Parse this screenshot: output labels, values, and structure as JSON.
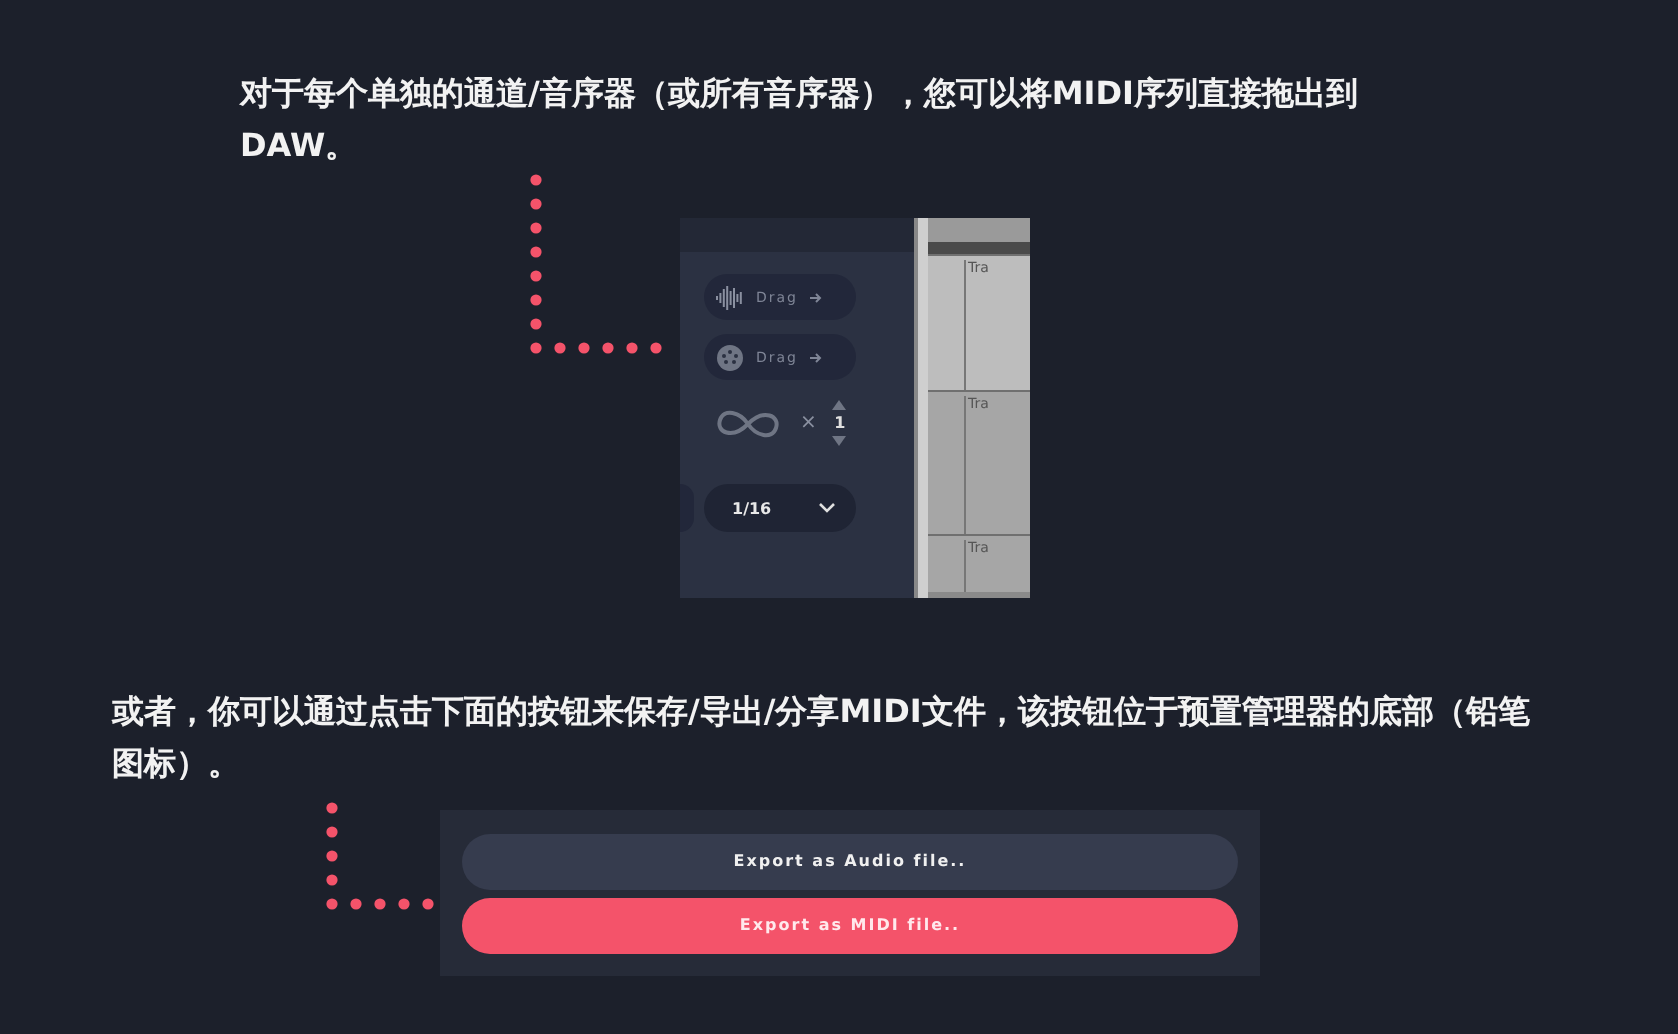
{
  "intro": {
    "text": "对于每个单独的通道/音序器（或所有音序器），您可以将MIDI序列直接拖出到DAW。"
  },
  "daw_view": {
    "drag_buttons": [
      {
        "kind": "audio",
        "label": "Drag"
      },
      {
        "kind": "midi",
        "label": "Drag"
      }
    ],
    "loop_multiplier": "×",
    "loop_count": "1",
    "grid_value": "1/16",
    "track_labels": [
      "Tra",
      "Tra",
      "Tra"
    ]
  },
  "note": {
    "text": "或者，你可以通过点击下面的按钮来保存/导出/分享MIDI文件，该按钮位于预置管理器的底部（铅笔图标）。"
  },
  "export_panel": {
    "buttons": [
      {
        "label": "Export as Audio file..",
        "selected": false
      },
      {
        "label": "Export as MIDI file..",
        "selected": true
      }
    ]
  }
}
